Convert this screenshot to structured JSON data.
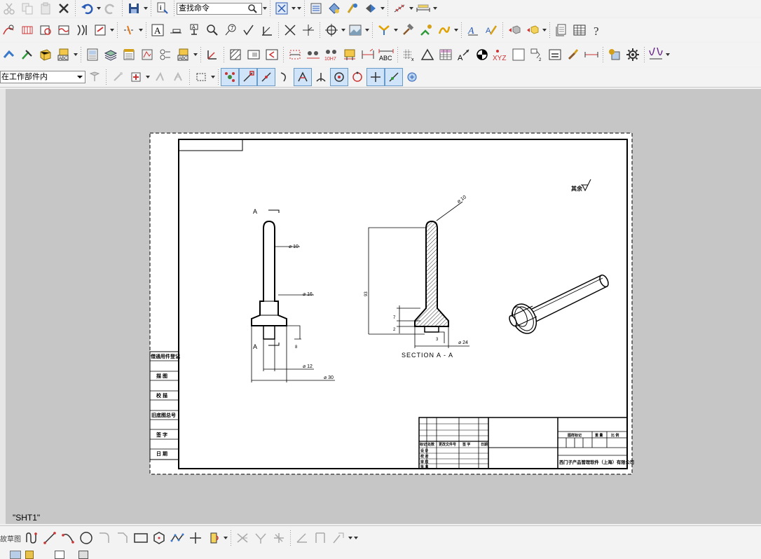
{
  "toolbar": {
    "command_search": {
      "placeholder": "查找命令"
    },
    "selection_scope": {
      "value": "在工作部件内"
    }
  },
  "status": {
    "sheet_name": "\"SHT1\""
  },
  "sketch_toolbar": {
    "cut_label": "故草图"
  },
  "drawing": {
    "views": {
      "front": {
        "section_marker_top": "A",
        "section_marker_bottom": "A",
        "dims": [
          "⌀ 10",
          "⌀ 16",
          "⌀ 12",
          "⌀ 30"
        ]
      },
      "section": {
        "title": "SECTION  A - A",
        "dims": [
          "⌀ 10",
          "⌀ 24",
          "93",
          "7",
          "2",
          "3"
        ]
      }
    },
    "roughness_label": "其余",
    "revision_block": [
      "借通用件登记",
      "描 图",
      "校 描",
      "旧底图总号",
      "签 字",
      "日 期"
    ],
    "title_block": {
      "header_cells": [
        "标记",
        "处数",
        "更改文件号",
        "签 字",
        "日期"
      ],
      "role_cells": [
        "设 计",
        "校 对",
        "审 核",
        "批 准"
      ],
      "stage_headers": [
        "图样标记",
        "重 量",
        "比 例"
      ],
      "company": "西门子产品管理软件（上海）有限公司"
    }
  }
}
